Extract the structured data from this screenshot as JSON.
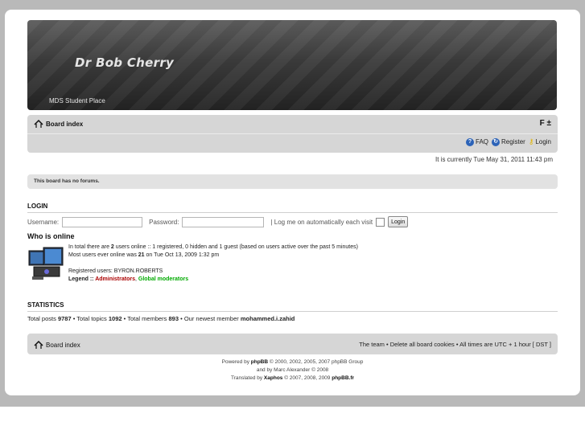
{
  "header": {
    "site_title": "Dr Bob Cherry",
    "site_description": "MDS Student Place"
  },
  "navbar": {
    "breadcrumb": "Board index",
    "font_resize": "F ±",
    "links": {
      "faq": "FAQ",
      "register": "Register",
      "login": "Login"
    },
    "icons": {
      "faq": "help-icon",
      "register": "register-icon",
      "login": "key-icon",
      "home": "home-icon"
    }
  },
  "current_time": "It is currently Tue May 31, 2011 11:43 pm",
  "notice": "This board has no forums.",
  "login_section": {
    "heading": "LOGIN",
    "username_label": "Username:",
    "username_value": "",
    "password_label": "Password:",
    "password_value": "",
    "auto_login_label": "| Log me on automatically each visit",
    "login_button": "Login"
  },
  "who_is_online": {
    "heading": "Who is online",
    "line1_pre": "In total there are ",
    "line1_count": "2",
    "line1_post": " users online :: 1 registered, 0 hidden and 1 guest (based on users active over the past 5 minutes)",
    "line2_pre": "Most users ever online was ",
    "line2_count": "21",
    "line2_post": " on Tue Oct 13, 2009 1:32 pm",
    "registered": "Registered users: BYRON.ROBERTS",
    "legend_label": "Legend :: ",
    "legend_admin": "Administrators",
    "legend_sep": ", ",
    "legend_gmod": "Global moderators",
    "colors": {
      "admin": "#AA0000",
      "gmod": "#00AA00"
    }
  },
  "statistics": {
    "heading": "STATISTICS",
    "posts_label": "Total posts ",
    "posts": "9787",
    "topics_label": " • Total topics ",
    "topics": "1092",
    "members_label": " • Total members ",
    "members": "893",
    "newest_label": " • Our newest member ",
    "newest_member": "mohammed.i.zahid"
  },
  "footer": {
    "breadcrumb": "Board index",
    "links": "The team • Delete all board cookies • All times are UTC + 1 hour [ DST ]"
  },
  "credits": {
    "line1_pre": "Powered by ",
    "line1_brand": "phpBB",
    "line1_post": " © 2000, 2002, 2005, 2007 phpBB Group",
    "line2": "and by Marc Alexander © 2008",
    "line3_pre": "Translated by ",
    "line3_brand": "Xaphos",
    "line3_mid": " © 2007, 2008, 2009 ",
    "line3_brand2": "phpBB.fr"
  }
}
